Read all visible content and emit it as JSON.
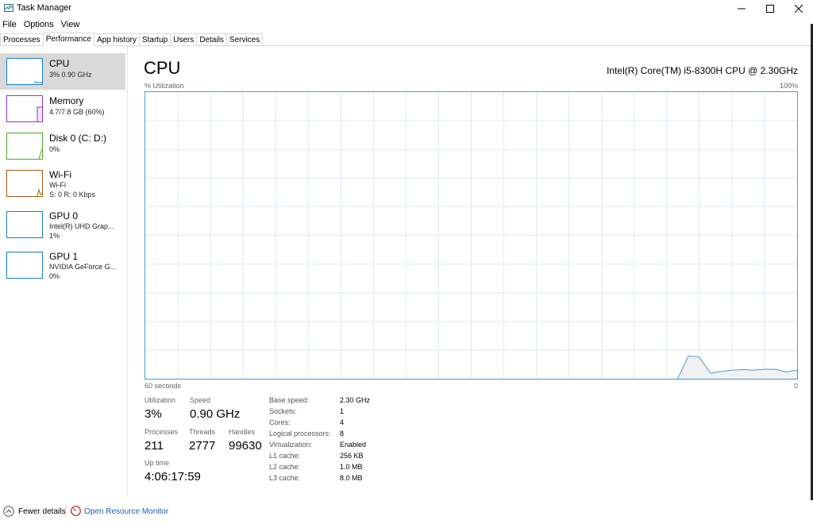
{
  "window": {
    "title": "Task Manager"
  },
  "menu": [
    "File",
    "Options",
    "View"
  ],
  "tabs": [
    "Processes",
    "Performance",
    "App history",
    "Startup",
    "Users",
    "Details",
    "Services"
  ],
  "sidebar": {
    "items": [
      {
        "name": "CPU",
        "sub1": "3% 0.90 GHz",
        "sub2": "",
        "color": "#1a7ec4"
      },
      {
        "name": "Memory",
        "sub1": "4.7/7.8 GB (60%)",
        "sub2": "",
        "color": "#9b30c0"
      },
      {
        "name": "Disk 0 (C: D:)",
        "sub1": "0%",
        "sub2": "",
        "color": "#4aa829"
      },
      {
        "name": "Wi-Fi",
        "sub1": "Wi-Fi",
        "sub2": "S: 0 R: 0 Kbps",
        "color": "#a75b14"
      },
      {
        "name": "GPU 0",
        "sub1": "Intel(R) UHD Grap...",
        "sub2": "1%",
        "color": "#1a7ec4"
      },
      {
        "name": "GPU 1",
        "sub1": "NVIDIA GeForce G...",
        "sub2": "0%",
        "color": "#1a7ec4"
      }
    ]
  },
  "main": {
    "title": "CPU",
    "model": "Intel(R) Core(TM) i5-8300H CPU @ 2.30GHz",
    "util_label": "% Utilization",
    "max_label": "100%",
    "time_label": "60 seconds",
    "min_label": "0",
    "graph_color": "#4a9bd1",
    "utilization_series": [
      0,
      0,
      0,
      0,
      0,
      0,
      0,
      0,
      0,
      0,
      0,
      0,
      0,
      0,
      0,
      0,
      0,
      0,
      0,
      0,
      0,
      0,
      0,
      0,
      0,
      0,
      0,
      0,
      0,
      0,
      0,
      0,
      0,
      0,
      0,
      0,
      0,
      0,
      0,
      0,
      0,
      0,
      0,
      0,
      0,
      0,
      0,
      0,
      0,
      0,
      8,
      7.5,
      2,
      2.5,
      3,
      3.2,
      3,
      3.3,
      3.3,
      2.4,
      3
    ]
  },
  "stats": {
    "utilization": {
      "label": "Utilization",
      "value": "3%"
    },
    "speed": {
      "label": "Speed",
      "value": "0.90 GHz"
    },
    "processes": {
      "label": "Processes",
      "value": "211"
    },
    "threads": {
      "label": "Threads",
      "value": "2777"
    },
    "handles": {
      "label": "Handles",
      "value": "99630"
    },
    "uptime": {
      "label": "Up time",
      "value": "4:06:17:59"
    }
  },
  "specs": [
    {
      "label": "Base speed:",
      "value": "2.30 GHz"
    },
    {
      "label": "Sockets:",
      "value": "1"
    },
    {
      "label": "Cores:",
      "value": "4"
    },
    {
      "label": "Logical processors:",
      "value": "8"
    },
    {
      "label": "Virtualization:",
      "value": "Enabled"
    },
    {
      "label": "L1 cache:",
      "value": "256 KB"
    },
    {
      "label": "L2 cache:",
      "value": "1.0 MB"
    },
    {
      "label": "L3 cache:",
      "value": "8.0 MB"
    }
  ],
  "footer": {
    "fewer_details": "Fewer details",
    "resource_monitor": "Open Resource Monitor"
  }
}
